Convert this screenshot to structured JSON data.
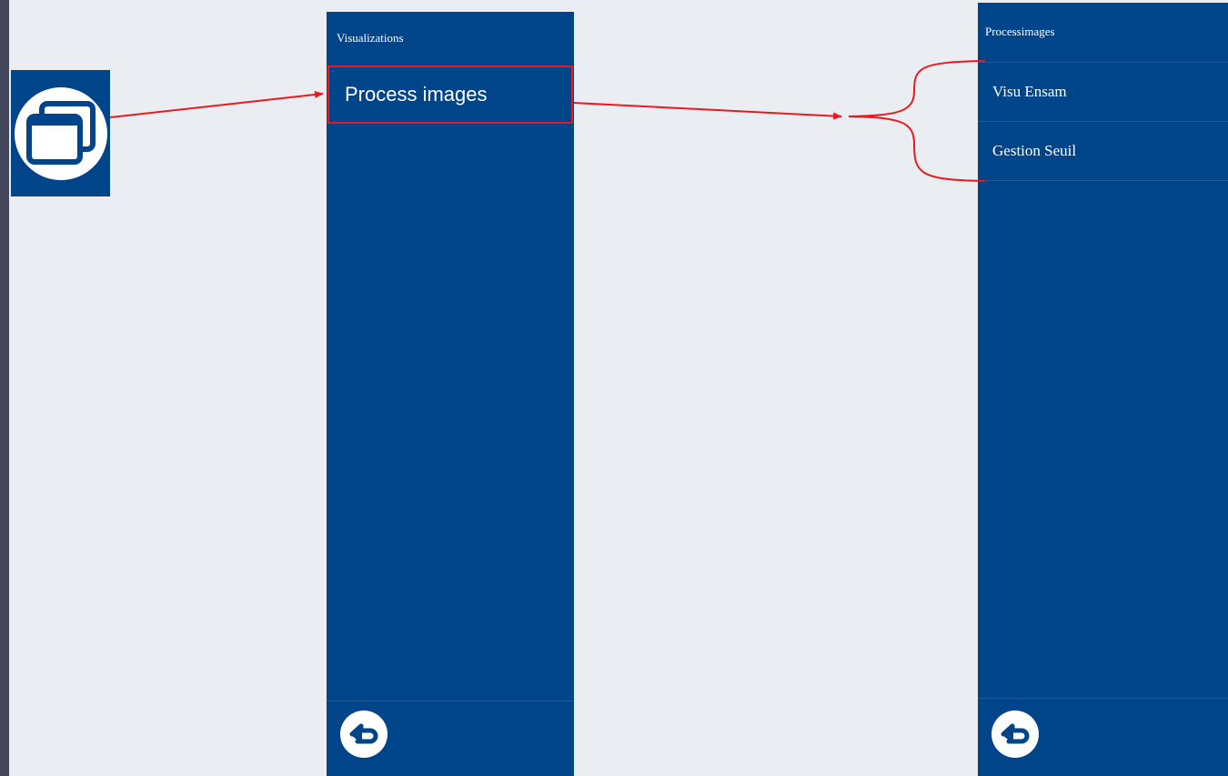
{
  "colors": {
    "panel_bg": "#004489",
    "page_bg": "#eaedf1",
    "highlight": "#e8191f",
    "text": "#ffffff"
  },
  "app_icon": {
    "icon": "windows-stack-icon"
  },
  "panel_visualizations": {
    "title": "Visualizations",
    "items": [
      {
        "label": "Process images",
        "highlighted": true
      }
    ],
    "back_icon": "back-arrow-icon"
  },
  "panel_processimages": {
    "title": "Processimages",
    "items": [
      {
        "label": "Visu Ensam"
      },
      {
        "label": "Gestion Seuil"
      }
    ],
    "back_icon": "back-arrow-icon"
  }
}
